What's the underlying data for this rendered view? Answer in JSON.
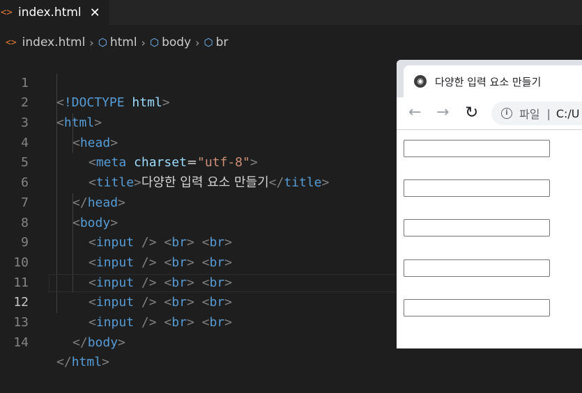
{
  "editor": {
    "tab": {
      "icon": "html-file-icon",
      "glyph": "<>",
      "filename": "index.html",
      "close_glyph": "✕"
    },
    "breadcrumb": {
      "file": "index.html",
      "items": [
        "html",
        "body",
        "br"
      ]
    },
    "active_line": 12,
    "lines": [
      {
        "n": "1"
      },
      {
        "n": "2"
      },
      {
        "n": "3"
      },
      {
        "n": "4"
      },
      {
        "n": "5"
      },
      {
        "n": "6"
      },
      {
        "n": "7"
      },
      {
        "n": "8"
      },
      {
        "n": "9"
      },
      {
        "n": "10"
      },
      {
        "n": "11"
      },
      {
        "n": "12"
      },
      {
        "n": "13"
      },
      {
        "n": "14"
      }
    ],
    "code": {
      "doctype": "!DOCTYPE",
      "doctype_val": "html",
      "html": "html",
      "head": "head",
      "meta": "meta",
      "charset_attr": "charset",
      "charset_val": "\"utf-8\"",
      "title": "title",
      "title_text": "다양한 입력 요소 만들기",
      "body": "body",
      "input": "input",
      "br": "br"
    },
    "colors": {
      "tag": "#569cd6",
      "attr": "#9cdcfe",
      "string": "#ce9178",
      "bracket": "#808080",
      "text": "#d4d4d4"
    }
  },
  "browser": {
    "tab_title": "다양한 입력 요소 만들기",
    "omnibox_scheme": "파일",
    "omnibox_path": "C:/U",
    "inputs": [
      "",
      "",
      "",
      "",
      ""
    ]
  }
}
